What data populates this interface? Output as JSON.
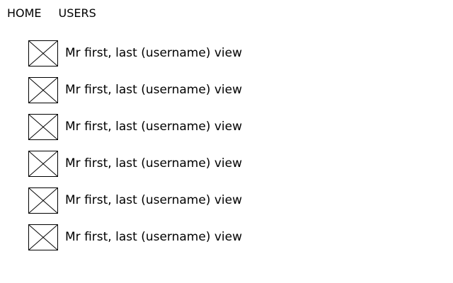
{
  "nav": {
    "items": [
      {
        "label": "HOME"
      },
      {
        "label": "USERS"
      }
    ]
  },
  "users": [
    {
      "title": "Mr",
      "first": "first,",
      "last": "last",
      "username": "(username)",
      "action": "view",
      "avatar": "broken-image-placeholder"
    },
    {
      "title": "Mr",
      "first": "first,",
      "last": "last",
      "username": "(username)",
      "action": "view",
      "avatar": "broken-image-placeholder"
    },
    {
      "title": "Mr",
      "first": "first,",
      "last": "last",
      "username": "(username)",
      "action": "view",
      "avatar": "broken-image-placeholder"
    },
    {
      "title": "Mr",
      "first": "first,",
      "last": "last",
      "username": "(username)",
      "action": "view",
      "avatar": "broken-image-placeholder"
    },
    {
      "title": "Mr",
      "first": "first,",
      "last": "last",
      "username": "(username)",
      "action": "view",
      "avatar": "broken-image-placeholder"
    },
    {
      "title": "Mr",
      "first": "first,",
      "last": "last",
      "username": "(username)",
      "action": "view",
      "avatar": "broken-image-placeholder"
    }
  ]
}
